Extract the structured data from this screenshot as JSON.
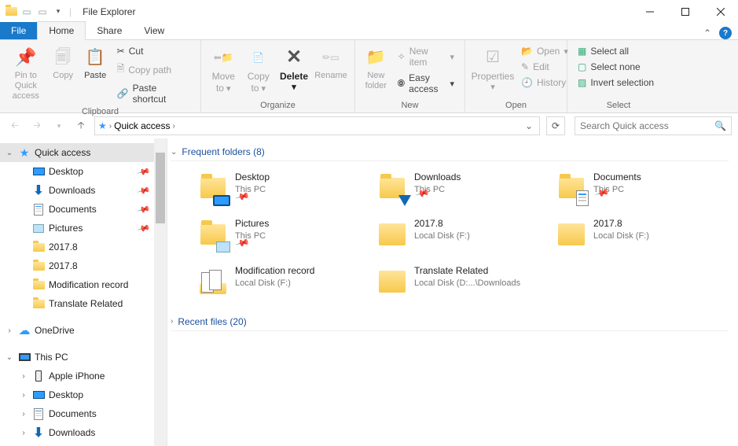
{
  "window": {
    "title": "File Explorer"
  },
  "tabs": {
    "file": "File",
    "home": "Home",
    "share": "Share",
    "view": "View"
  },
  "ribbon": {
    "clipboard": {
      "label": "Clipboard",
      "pin": "Pin to Quick access",
      "copy": "Copy",
      "paste": "Paste",
      "cut": "Cut",
      "copypath": "Copy path",
      "pasteshortcut": "Paste shortcut"
    },
    "organize": {
      "label": "Organize",
      "moveto": "Move to",
      "copyto": "Copy to",
      "delete": "Delete",
      "rename": "Rename"
    },
    "new": {
      "label": "New",
      "newfolder": "New folder",
      "newitem": "New item",
      "easyaccess": "Easy access"
    },
    "open": {
      "label": "Open",
      "properties": "Properties",
      "open": "Open",
      "edit": "Edit",
      "history": "History"
    },
    "select": {
      "label": "Select",
      "selectall": "Select all",
      "selectnone": "Select none",
      "invert": "Invert selection"
    }
  },
  "breadcrumb": {
    "root": "Quick access"
  },
  "search": {
    "placeholder": "Search Quick access"
  },
  "sidebar": {
    "quickaccess": "Quick access",
    "items": [
      {
        "label": "Desktop",
        "icon": "desktop",
        "pinned": true
      },
      {
        "label": "Downloads",
        "icon": "download",
        "pinned": true
      },
      {
        "label": "Documents",
        "icon": "document",
        "pinned": true
      },
      {
        "label": "Pictures",
        "icon": "picture",
        "pinned": true
      },
      {
        "label": "2017.8",
        "icon": "folder",
        "pinned": false
      },
      {
        "label": "2017.8",
        "icon": "folder",
        "pinned": false
      },
      {
        "label": "Modification record",
        "icon": "folder",
        "pinned": false
      },
      {
        "label": "Translate Related",
        "icon": "folder",
        "pinned": false
      }
    ],
    "onedrive": "OneDrive",
    "thispc": "This PC",
    "pcitems": [
      {
        "label": "Apple iPhone",
        "icon": "phone"
      },
      {
        "label": "Desktop",
        "icon": "desktop"
      },
      {
        "label": "Documents",
        "icon": "document"
      },
      {
        "label": "Downloads",
        "icon": "download"
      }
    ]
  },
  "sections": {
    "frequent": {
      "title": "Frequent folders (8)"
    },
    "recent": {
      "title": "Recent files (20)"
    }
  },
  "folders": [
    {
      "name": "Desktop",
      "loc": "This PC",
      "pinned": true,
      "overlay": "monitor"
    },
    {
      "name": "Downloads",
      "loc": "This PC",
      "pinned": true,
      "overlay": "arrow"
    },
    {
      "name": "Documents",
      "loc": "This PC",
      "pinned": true,
      "overlay": "doc"
    },
    {
      "name": "Pictures",
      "loc": "This PC",
      "pinned": true,
      "overlay": "pic"
    },
    {
      "name": "2017.8",
      "loc": "Local Disk (F:)",
      "pinned": false,
      "overlay": "open"
    },
    {
      "name": "2017.8",
      "loc": "Local Disk (F:)",
      "pinned": false,
      "overlay": "open"
    },
    {
      "name": "Modification record",
      "loc": "Local Disk (F:)",
      "pinned": false,
      "overlay": "pages"
    },
    {
      "name": "Translate Related",
      "loc": "Local Disk (D:...\\Downloads",
      "pinned": false,
      "overlay": "open"
    }
  ]
}
